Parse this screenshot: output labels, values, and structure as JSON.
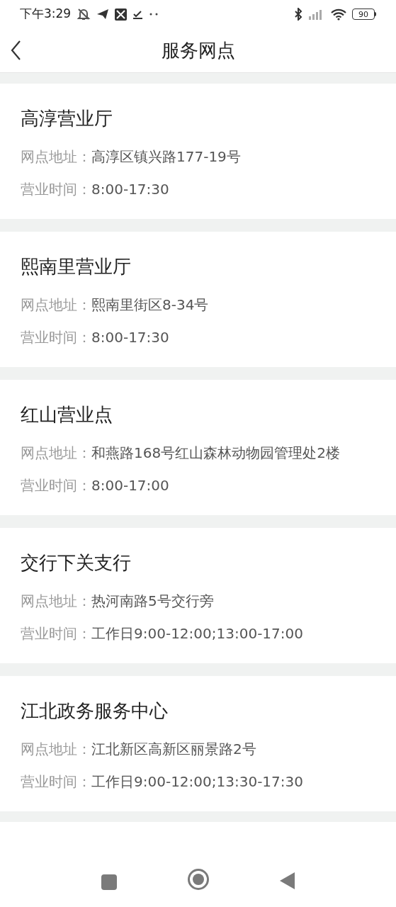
{
  "status_bar": {
    "time": "下午3:29",
    "battery": "90"
  },
  "header": {
    "title": "服务网点"
  },
  "outlets": [
    {
      "name": "高淳营业厅",
      "address_label": "网点地址：",
      "address": "高淳区镇兴路177-19号",
      "hours_label": "营业时间：",
      "hours": "8:00-17:30"
    },
    {
      "name": "熙南里营业厅",
      "address_label": "网点地址：",
      "address": "熙南里街区8-34号",
      "hours_label": "营业时间：",
      "hours": "8:00-17:30"
    },
    {
      "name": "红山营业点",
      "address_label": "网点地址：",
      "address": "和燕路168号红山森林动物园管理处2楼",
      "hours_label": "营业时间：",
      "hours": "8:00-17:00"
    },
    {
      "name": "交行下关支行",
      "address_label": "网点地址：",
      "address": "热河南路5号交行旁",
      "hours_label": "营业时间：",
      "hours": "工作日9:00-12:00;13:00-17:00"
    },
    {
      "name": "江北政务服务中心",
      "address_label": "网点地址：",
      "address": "江北新区高新区丽景路2号",
      "hours_label": "营业时间：",
      "hours": "工作日9:00-12:00;13:30-17:30"
    }
  ]
}
